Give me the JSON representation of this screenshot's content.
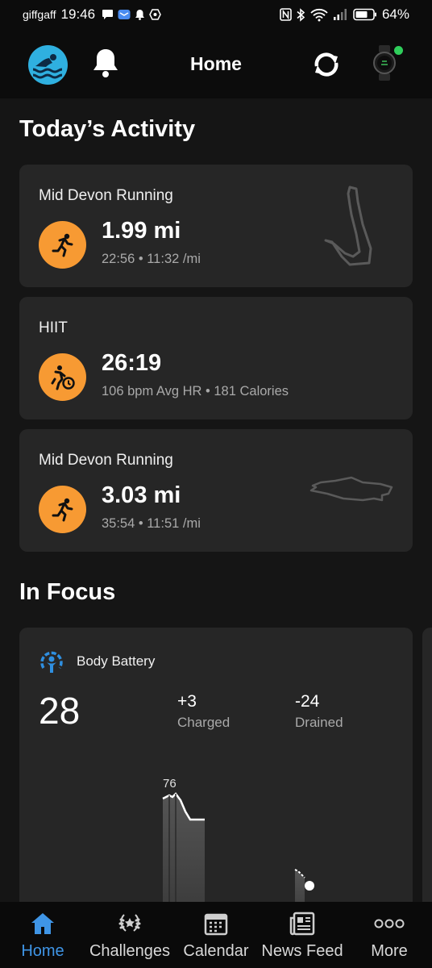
{
  "status_bar": {
    "carrier": "giffgaff",
    "time": "19:46",
    "battery": "64%"
  },
  "header": {
    "title": "Home",
    "watch_connected_color": "#2fce5b"
  },
  "todays_activity": {
    "title": "Today’s Activity",
    "activities": [
      {
        "name": "Mid Devon Running",
        "value": "1.99 mi",
        "details": "22:56 • 11:32 /mi",
        "icon": "running-icon"
      },
      {
        "name": "HIIT",
        "value": "26:19",
        "details": "106 bpm Avg HR • 181 Calories",
        "icon": "hiit-icon"
      },
      {
        "name": "Mid Devon Running",
        "value": "3.03 mi",
        "details": "35:54 • 11:51 /mi",
        "icon": "running-icon"
      }
    ]
  },
  "in_focus": {
    "title": "In Focus",
    "body_battery": {
      "title": "Body Battery",
      "level": "28",
      "charged_value": "+3",
      "charged_label": "Charged",
      "drained_value": "-24",
      "drained_label": "Drained",
      "peak_label": "76"
    }
  },
  "bottom_nav": {
    "items": [
      {
        "label": "Home",
        "icon": "home-icon",
        "active": true
      },
      {
        "label": "Challenges",
        "icon": "laurel-icon",
        "active": false
      },
      {
        "label": "Calendar",
        "icon": "calendar-icon",
        "active": false
      },
      {
        "label": "News Feed",
        "icon": "newsfeed-icon",
        "active": false
      },
      {
        "label": "More",
        "icon": "more-icon",
        "active": false
      }
    ]
  },
  "colors": {
    "accent_blue": "#3f95e6",
    "activity_orange": "#f79a33",
    "card_bg": "#262626"
  }
}
